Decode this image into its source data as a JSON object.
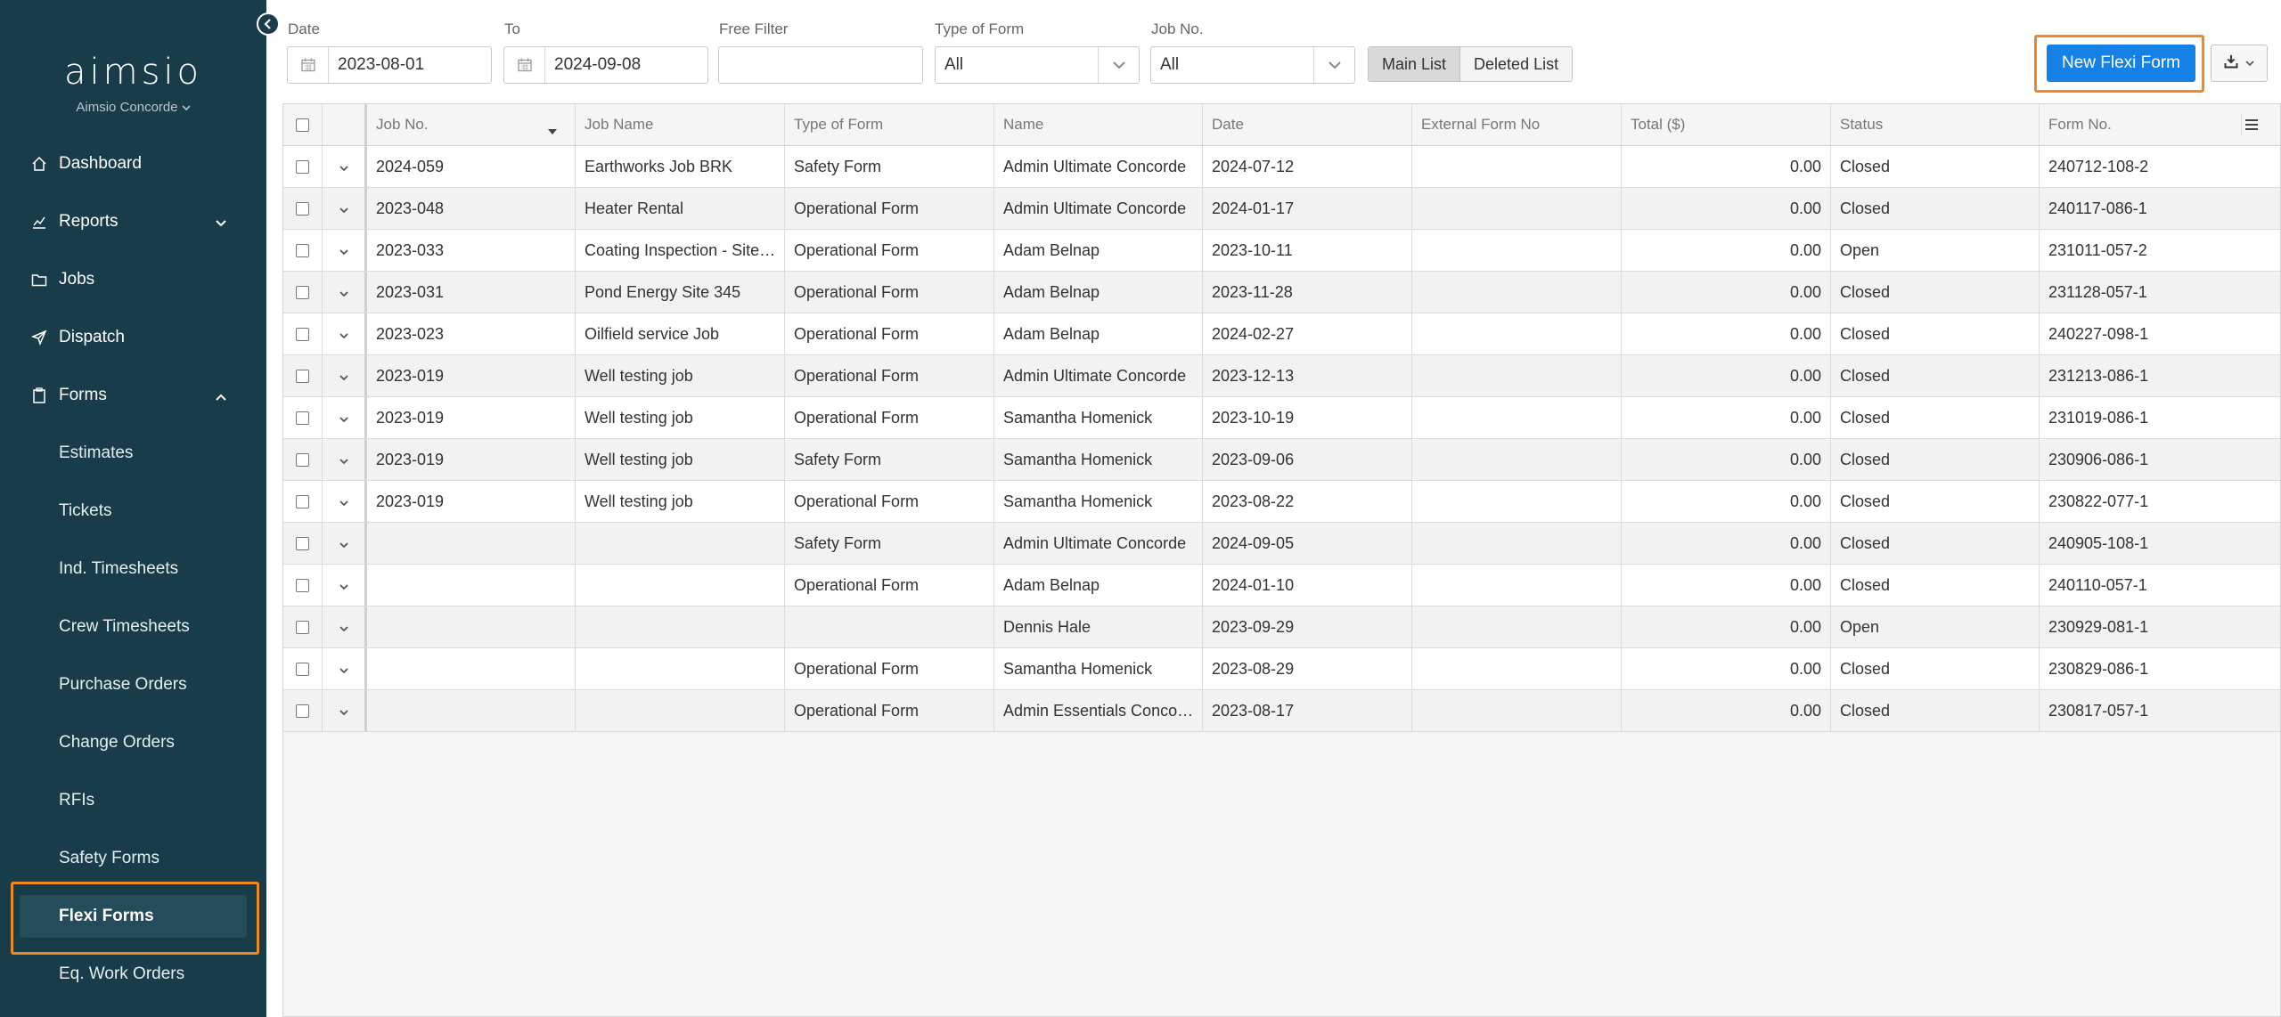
{
  "sidebar": {
    "logo": "aimsio",
    "company": "Aimsio Concorde",
    "nav": [
      {
        "label": "Dashboard",
        "icon": "home-icon"
      },
      {
        "label": "Reports",
        "icon": "chart-icon"
      },
      {
        "label": "Jobs",
        "icon": "folder-icon"
      },
      {
        "label": "Dispatch",
        "icon": "send-icon"
      },
      {
        "label": "Forms",
        "icon": "clipboard-icon"
      }
    ],
    "forms_sub": [
      "Estimates",
      "Tickets",
      "Ind. Timesheets",
      "Crew Timesheets",
      "Purchase Orders",
      "Change Orders",
      "RFIs",
      "Safety Forms",
      "Flexi Forms",
      "Eq. Work Orders"
    ],
    "active": "Flexi Forms"
  },
  "filters": {
    "date_label": "Date",
    "date_from": "2023-08-01",
    "to_label": "To",
    "date_to": "2024-09-08",
    "free_filter_label": "Free Filter",
    "free_filter_value": "",
    "type_label": "Type of Form",
    "type_value": "All",
    "job_label": "Job No.",
    "job_value": "All"
  },
  "toolbar": {
    "main_list": "Main List",
    "deleted_list": "Deleted List",
    "new_button": "New Flexi Form"
  },
  "table": {
    "headers": [
      "Job No.",
      "Job Name",
      "Type of Form",
      "Name",
      "Date",
      "External Form No",
      "Total ($)",
      "Status",
      "Form No."
    ],
    "rows": [
      [
        "2024-059",
        "Earthworks Job BRK",
        "Safety Form",
        "Admin Ultimate Concorde",
        "2024-07-12",
        "",
        "0.00",
        "Closed",
        "240712-108-2"
      ],
      [
        "2023-048",
        "Heater Rental",
        "Operational Form",
        "Admin Ultimate Concorde",
        "2024-01-17",
        "",
        "0.00",
        "Closed",
        "240117-086-1"
      ],
      [
        "2023-033",
        "Coating Inspection - Site…",
        "Operational Form",
        "Adam Belnap",
        "2023-10-11",
        "",
        "0.00",
        "Open",
        "231011-057-2"
      ],
      [
        "2023-031",
        "Pond Energy Site 345",
        "Operational Form",
        "Adam Belnap",
        "2023-11-28",
        "",
        "0.00",
        "Closed",
        "231128-057-1"
      ],
      [
        "2023-023",
        "Oilfield service Job",
        "Operational Form",
        "Adam Belnap",
        "2024-02-27",
        "",
        "0.00",
        "Closed",
        "240227-098-1"
      ],
      [
        "2023-019",
        "Well testing job",
        "Operational Form",
        "Admin Ultimate Concorde",
        "2023-12-13",
        "",
        "0.00",
        "Closed",
        "231213-086-1"
      ],
      [
        "2023-019",
        "Well testing job",
        "Operational Form",
        "Samantha Homenick",
        "2023-10-19",
        "",
        "0.00",
        "Closed",
        "231019-086-1"
      ],
      [
        "2023-019",
        "Well testing job",
        "Safety Form",
        "Samantha Homenick",
        "2023-09-06",
        "",
        "0.00",
        "Closed",
        "230906-086-1"
      ],
      [
        "2023-019",
        "Well testing job",
        "Operational Form",
        "Samantha Homenick",
        "2023-08-22",
        "",
        "0.00",
        "Closed",
        "230822-077-1"
      ],
      [
        "",
        "",
        "Safety Form",
        "Admin Ultimate Concorde",
        "2024-09-05",
        "",
        "0.00",
        "Closed",
        "240905-108-1"
      ],
      [
        "",
        "",
        "Operational Form",
        "Adam Belnap",
        "2024-01-10",
        "",
        "0.00",
        "Closed",
        "240110-057-1"
      ],
      [
        "",
        "",
        "",
        "Dennis Hale",
        "2023-09-29",
        "",
        "0.00",
        "Open",
        "230929-081-1"
      ],
      [
        "",
        "",
        "Operational Form",
        "Samantha Homenick",
        "2023-08-29",
        "",
        "0.00",
        "Closed",
        "230829-086-1"
      ],
      [
        "",
        "",
        "Operational Form",
        "Admin Essentials Conco…",
        "2023-08-17",
        "",
        "0.00",
        "Closed",
        "230817-057-1"
      ]
    ]
  },
  "colors": {
    "sidebar_bg": "#183c4a",
    "primary_button": "#1580e6",
    "highlight": "#ee8a1e"
  }
}
